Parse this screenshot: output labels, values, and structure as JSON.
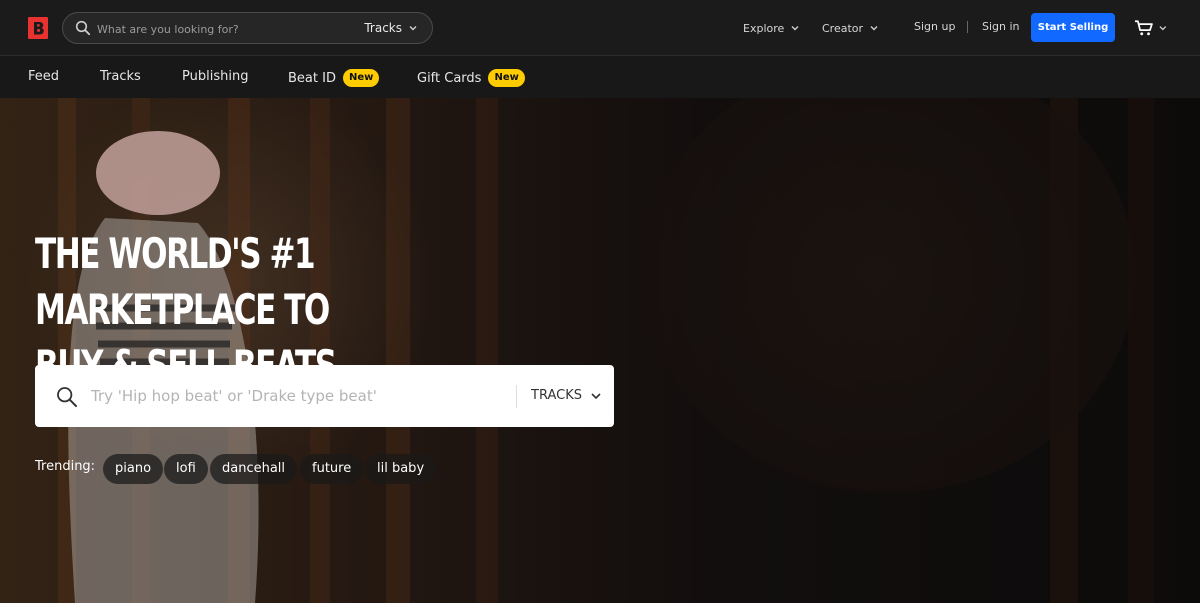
{
  "brand": {
    "accent": "#e8322f",
    "primary_blue": "#1269ff",
    "badge_yellow": "#ffcc00"
  },
  "header": {
    "search": {
      "placeholder": "What are you looking for?",
      "type": "Tracks",
      "icons": [
        "search-icon",
        "chevron-down-icon"
      ]
    },
    "nav": {
      "explore": "Explore",
      "creator": "Creator",
      "sign_up": "Sign up",
      "separator": "|",
      "sign_in": "Sign in",
      "start_selling": "Start Selling"
    }
  },
  "subnav": [
    {
      "label": "Feed"
    },
    {
      "label": "Tracks"
    },
    {
      "label": "Publishing"
    },
    {
      "label": "Beat ID",
      "badge": "New"
    },
    {
      "label": "Gift Cards",
      "badge": "New"
    }
  ],
  "hero": {
    "title_line1": "THE WORLD'S #1 MARKETPLACE TO",
    "title_line2": "BUY & SELL BEATS",
    "search_placeholder": "Try 'Hip hop beat' or 'Drake type beat'",
    "search_type": "TRACKS",
    "trending_label": "Trending:",
    "trending": [
      "piano",
      "lofi",
      "dancehall",
      "future",
      "lil baby"
    ]
  }
}
